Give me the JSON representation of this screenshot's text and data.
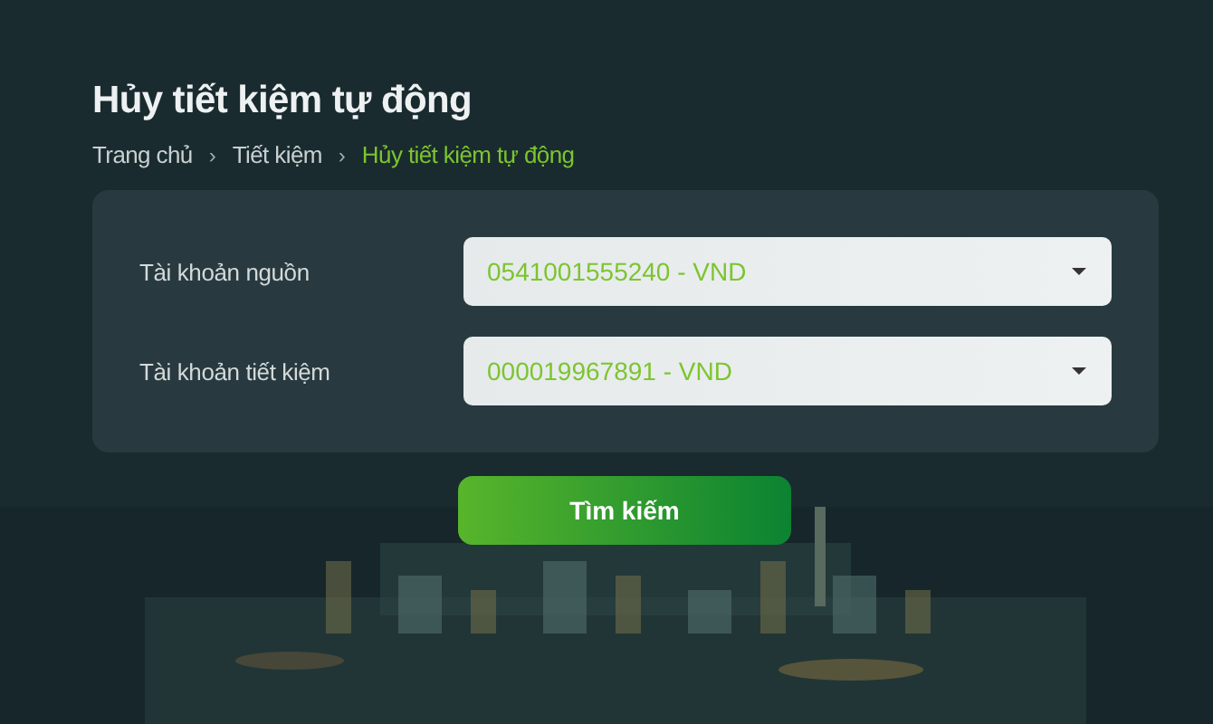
{
  "page": {
    "title": "Hủy tiết kiệm tự động"
  },
  "breadcrumb": [
    {
      "label": "Trang chủ",
      "selected": false
    },
    {
      "label": "Tiết kiệm",
      "selected": false
    },
    {
      "label": "Hủy tiết kiệm tự động",
      "selected": true
    }
  ],
  "separator": "›",
  "form": {
    "fields": [
      {
        "label": "Tài khoản nguồn",
        "value": "0541001555240 - VND"
      },
      {
        "label": "Tài khoản tiết kiệm",
        "value": "000019967891 - VND"
      }
    ]
  },
  "search_button": "Tìm kiếm"
}
